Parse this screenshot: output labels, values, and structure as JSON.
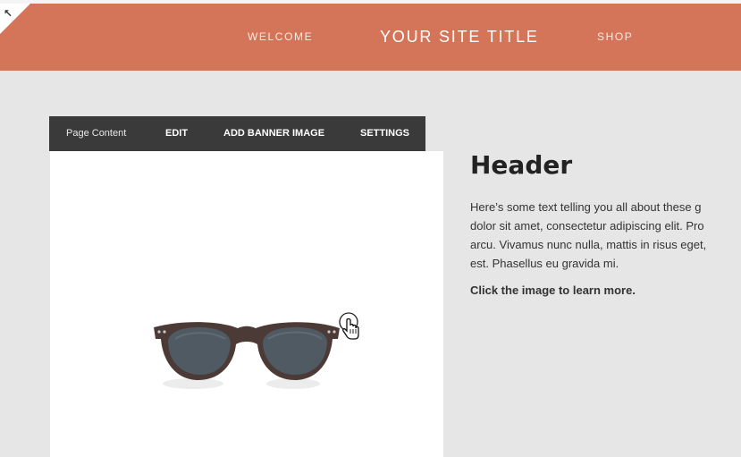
{
  "header": {
    "nav_left": "WELCOME",
    "site_title": "YOUR SITE TITLE",
    "nav_right": "SHOP",
    "background_color": "#d47559"
  },
  "toolbar": {
    "section_label": "Page Content",
    "edit_label": "EDIT",
    "banner_label": "ADD BANNER IMAGE",
    "settings_label": "SETTINGS"
  },
  "content": {
    "heading": "Header",
    "body_lines": [
      "Here’s some text telling you all about these g",
      "dolor sit amet, consectetur adipiscing elit. Pro",
      "arcu. Vivamus nunc nulla, mattis in risus eget,",
      "est. Phasellus eu gravida mi."
    ],
    "cta": "Click the image to learn more."
  },
  "icons": {
    "corner": "arrow-up-left-icon",
    "product": "sunglasses-image",
    "cursor": "hand-pointer-icon"
  }
}
